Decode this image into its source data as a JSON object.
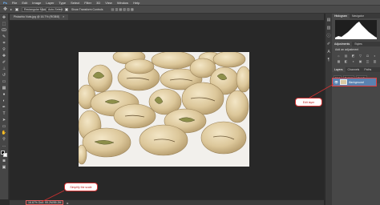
{
  "menubar": {
    "items": [
      "Ps",
      "File",
      "Edit",
      "Image",
      "Layer",
      "Type",
      "Select",
      "Filter",
      "3D",
      "View",
      "Window",
      "Help"
    ]
  },
  "options": {
    "tool_preset": "▸",
    "style_label": "Rectangular Marquee",
    "auto_select_label": "Auto-Select",
    "show_transform_label": "Show Transform Controls"
  },
  "document": {
    "tab_label": "Pistachio Nuts.jpg @ 16.7% (RGB/8)",
    "tab_close": "×",
    "zoom": "16.67% Doc: 55.2M/55.2M"
  },
  "panels": {
    "top_tabs": [
      "Histogram",
      "Navigator"
    ],
    "mid_tabs": [
      "Adjustments",
      "Styles"
    ],
    "adjustments_title": "Add an adjustment",
    "adjustment_icons": [
      "☼",
      "▤",
      "◩",
      "▽",
      "⚖",
      "◐",
      "▦",
      "◧",
      "◑",
      "▣",
      "◫",
      "▥"
    ],
    "layer_tabs": [
      "Layers",
      "Channels",
      "Paths"
    ],
    "layer_kind": "Kind",
    "layer_blend": "Normal",
    "layer_opacity": "Opacity",
    "layer_name": "Background",
    "layer_eye": "👁"
  },
  "callouts": {
    "layer": "Edit layer",
    "zoom": "Simplify the scale"
  },
  "colors": {
    "accent_red": "#d03030",
    "layer_selected": "#5a82b0"
  }
}
